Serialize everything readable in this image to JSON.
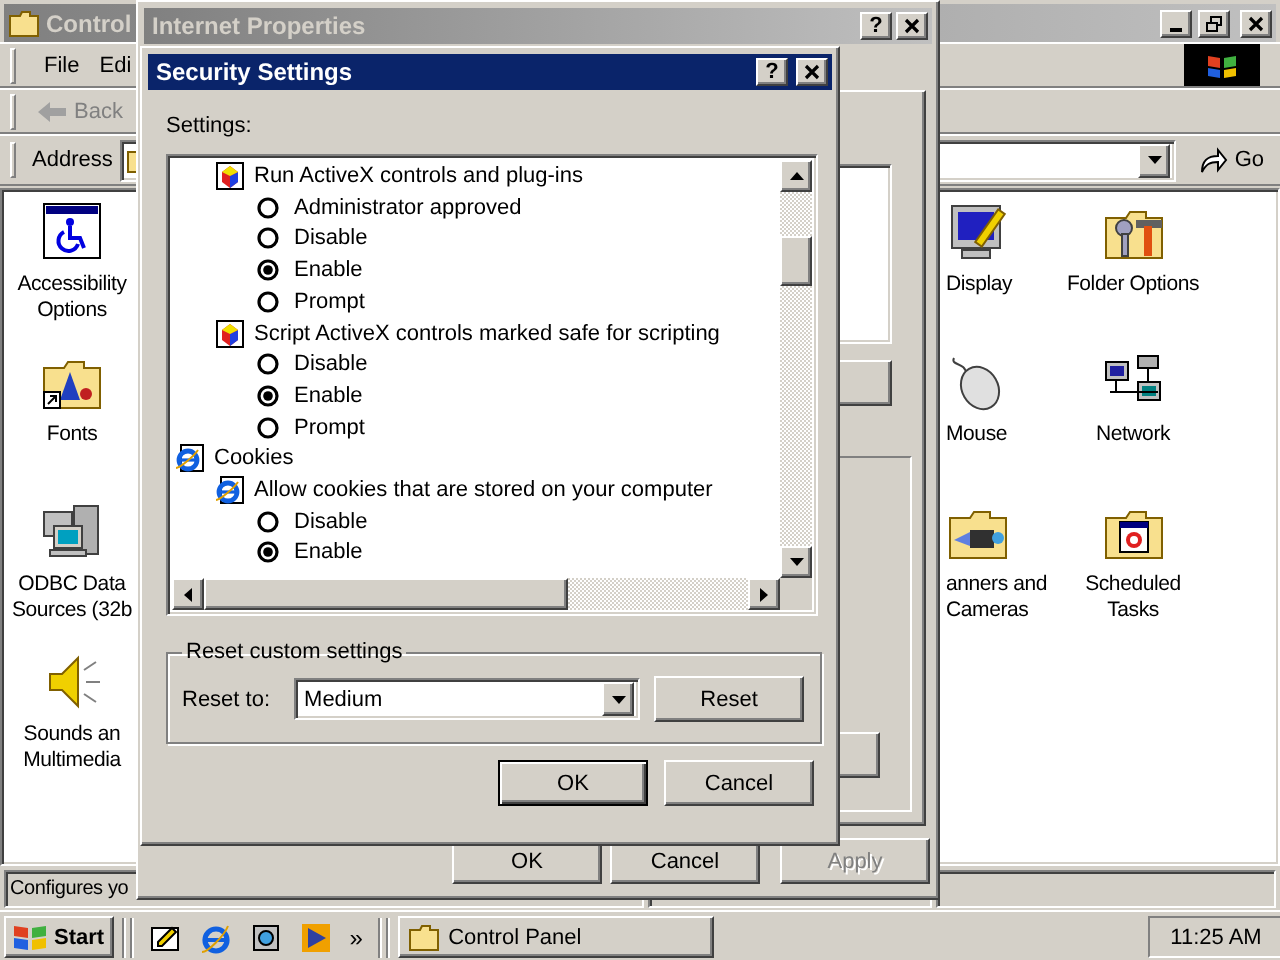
{
  "control_panel": {
    "title": "Control",
    "menu": [
      "File",
      "Edi"
    ],
    "toolbar": {
      "back": "Back"
    },
    "address": {
      "label": "Address",
      "go": "Go"
    },
    "icons_left": [
      {
        "label": "Accessibility Options"
      },
      {
        "label": "Fonts"
      },
      {
        "label": "ODBC Data Sources (32b"
      },
      {
        "label": "Sounds an Multimedia"
      }
    ],
    "icons_right": [
      {
        "label": "Display"
      },
      {
        "label": "Folder Options"
      },
      {
        "label": "Mouse"
      },
      {
        "label": "Network"
      },
      {
        "label": "anners and Cameras"
      },
      {
        "label": "Scheduled Tasks"
      }
    ],
    "status_bar": "Configures yo"
  },
  "internet_properties": {
    "title": "Internet Properties",
    "help": "?",
    "buttons": [
      {
        "label": "OK",
        "disabled": false
      },
      {
        "label": "Cancel",
        "disabled": false
      },
      {
        "label": "Apply",
        "disabled": true
      }
    ]
  },
  "security_settings": {
    "title": "Security Settings",
    "help": "?",
    "settings_label": "Settings:",
    "tree": [
      {
        "kind": "group",
        "children": [
          {
            "kind": "setting",
            "label": "Run ActiveX controls and plug-ins",
            "options": [
              {
                "label": "Administrator approved",
                "selected": false
              },
              {
                "label": "Disable",
                "selected": false
              },
              {
                "label": "Enable",
                "selected": true
              },
              {
                "label": "Prompt",
                "selected": false
              }
            ]
          },
          {
            "kind": "setting",
            "label": "Script ActiveX controls marked safe for scripting",
            "options": [
              {
                "label": "Disable",
                "selected": false
              },
              {
                "label": "Enable",
                "selected": true
              },
              {
                "label": "Prompt",
                "selected": false
              }
            ]
          }
        ]
      },
      {
        "kind": "category",
        "label": "Cookies",
        "children": [
          {
            "kind": "setting",
            "label": "Allow cookies that are stored on your computer",
            "options": [
              {
                "label": "Disable",
                "selected": false
              },
              {
                "label": "Enable",
                "selected": true
              }
            ]
          }
        ]
      }
    ],
    "reset_group": {
      "title": "Reset custom settings",
      "label": "Reset to:",
      "value": "Medium",
      "button": "Reset"
    },
    "buttons": [
      {
        "label": "OK",
        "default": true
      },
      {
        "label": "Cancel",
        "default": false
      }
    ]
  },
  "taskbar": {
    "start": "Start",
    "more": "»",
    "tasks": [
      {
        "label": "Control Panel",
        "selected": false
      }
    ],
    "clock": "11:25 AM"
  }
}
